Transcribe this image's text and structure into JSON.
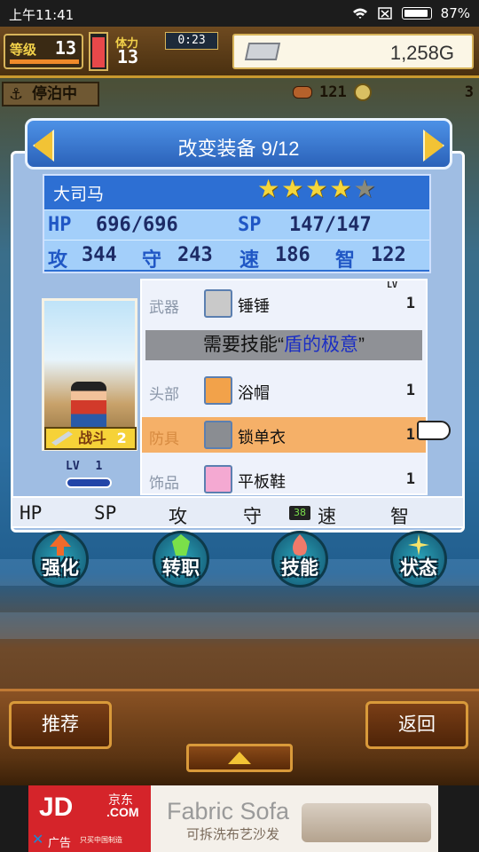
{
  "status_bar": {
    "time": "上午11:41",
    "battery": "87%",
    "icons": [
      "wifi-icon",
      "sim-off-icon",
      "battery-icon"
    ]
  },
  "hud": {
    "level_label": "等级",
    "level_value": "13",
    "stamina_label": "体力",
    "stamina_value": "13",
    "timer": "0:23",
    "gold": "1,258G",
    "status": "停泊中",
    "food": "121",
    "resource2": "3"
  },
  "panel": {
    "title": "改变装备 9/12",
    "character_name": "大司马",
    "stars_filled": 4,
    "stars_total": 5,
    "stats": {
      "hp_label": "HP",
      "hp_value": "696/696",
      "sp_label": "SP",
      "sp_value": "147/147",
      "atk_label": "攻",
      "atk_value": "344",
      "def_label": "守",
      "def_value": "243",
      "spd_label": "速",
      "spd_value": "186",
      "int_label": "智",
      "int_value": "122"
    },
    "job": "战斗",
    "job_level": "2",
    "char_level_label": "LV",
    "char_level": "1",
    "lv_header": "LV"
  },
  "equipment": [
    {
      "slot": "武器",
      "icon": "hammer-icon",
      "name": "锤锤",
      "level": "1",
      "selected": false
    },
    {
      "slot": "头部",
      "icon": "hat-icon",
      "name": "浴帽",
      "level": "1",
      "selected": false
    },
    {
      "slot": "防具",
      "icon": "chainmail-icon",
      "name": "锁单衣",
      "level": "1",
      "selected": true
    },
    {
      "slot": "饰品",
      "icon": "shoe-icon",
      "name": "平板鞋",
      "level": "1",
      "selected": false
    }
  ],
  "skill_requirement": {
    "prefix": "需要技能“",
    "skill": "盾的极意",
    "suffix": "”"
  },
  "sort_bar": {
    "items": [
      "HP",
      "SP",
      "攻",
      "守",
      "速",
      "智"
    ],
    "badge": "38"
  },
  "actions": [
    {
      "label": "强化",
      "gem": "orange-arrow-icon",
      "gem_color": "#f06a2a"
    },
    {
      "label": "转职",
      "gem": "green-crystal-icon",
      "gem_color": "#7ae04a"
    },
    {
      "label": "技能",
      "gem": "flame-icon",
      "gem_color": "#f07a6a"
    },
    {
      "label": "状态",
      "gem": "sparkle-icon",
      "gem_color": "#f7e36a"
    }
  ],
  "bottom": {
    "recommend": "推荐",
    "back": "返回"
  },
  "ad": {
    "jd_logo": "JD",
    "jd_cn": "京东",
    "jd_com": ".COM",
    "ad_label": "广告",
    "jd_tag": "只买中国制造",
    "brand": "Fabric Sofa",
    "sub": "可拆洗布艺沙发"
  },
  "colors": {
    "panel_blue": "#2d6fd3",
    "selected_row": "#f5b068",
    "skill_name": "#1b2ec4",
    "gold_accent": "#d7b45a",
    "star_filled": "#f5d63b"
  }
}
